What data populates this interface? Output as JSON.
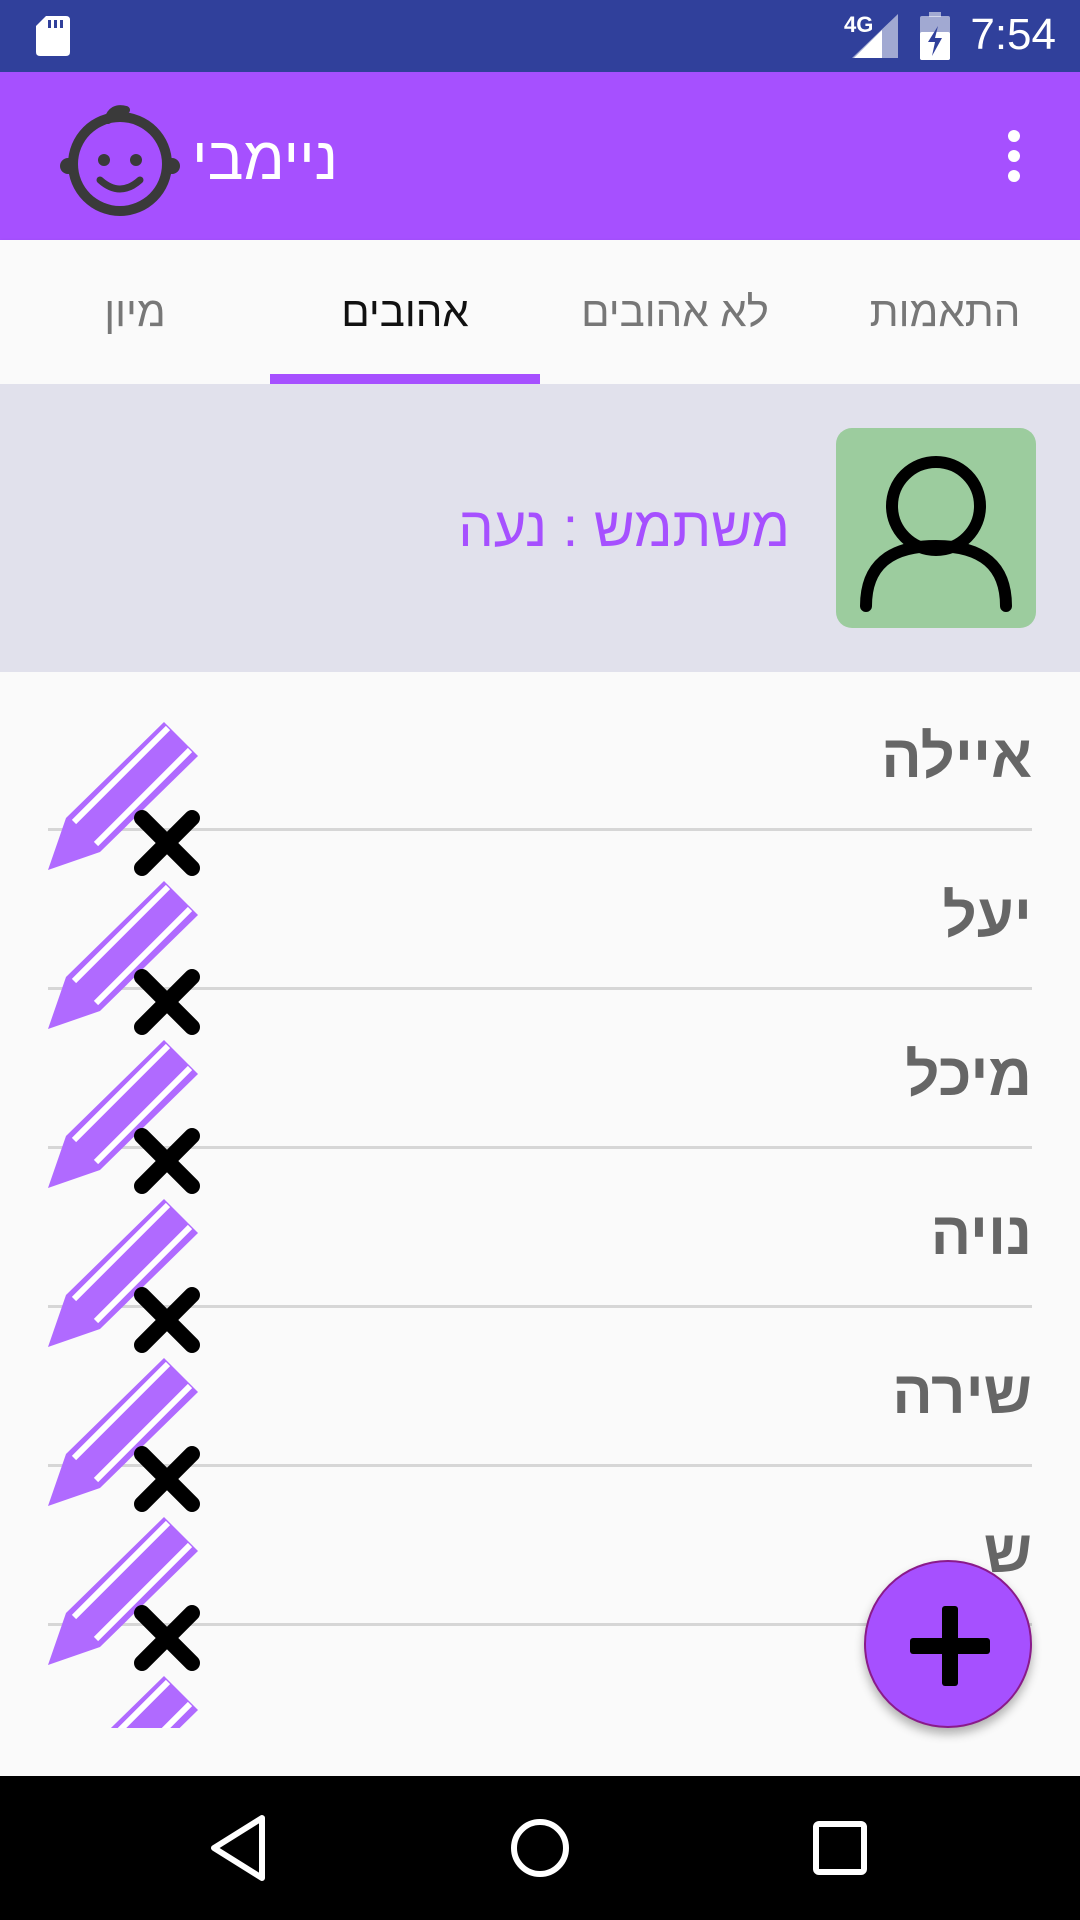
{
  "status_bar": {
    "time": "7:54",
    "network": "4G",
    "icons": [
      "sd-card-icon",
      "signal-icon",
      "battery-charging-icon"
    ]
  },
  "app_bar": {
    "title": "ניימבי",
    "logo_icon": "baby-face-icon",
    "menu_icon": "overflow-menu-icon"
  },
  "tabs": [
    {
      "label": "התאמות",
      "active": false
    },
    {
      "label": "לא אהובים",
      "active": false
    },
    {
      "label": "אהובים",
      "active": true
    },
    {
      "label": "מיון",
      "active": false
    }
  ],
  "user_panel": {
    "label": "משתמש : נעה",
    "avatar_icon": "person-icon"
  },
  "names": [
    {
      "name": "איילה"
    },
    {
      "name": "יעל"
    },
    {
      "name": "מיכל"
    },
    {
      "name": "נויה"
    },
    {
      "name": "שירה"
    },
    {
      "name": "ש"
    }
  ],
  "fab": {
    "icon": "plus-icon"
  },
  "colors": {
    "status_bar": "#30409b",
    "accent": "#a650ff",
    "user_panel": "#e1e1ec",
    "avatar_bg": "#9ccc9e"
  },
  "nav_bar": {
    "buttons": [
      "back-icon",
      "home-icon",
      "recents-icon"
    ]
  }
}
